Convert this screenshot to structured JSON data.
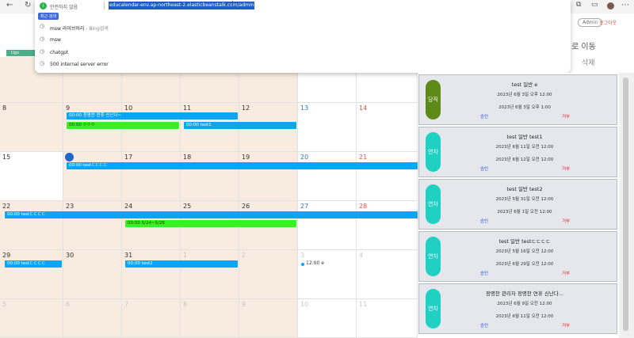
{
  "browser": {
    "security_label": "안전하지 않음",
    "url": "educalendar-env.ap-northeast-2.elasticbeanstalk.com/admin",
    "admin_label": "Admin",
    "logout_label": "로그아웃"
  },
  "omnibox": {
    "section_label": "최근 검색",
    "suggestions": [
      {
        "text": "msw 라이브러리",
        "sub": "- Bing검색"
      },
      {
        "text": "msw",
        "sub": ""
      },
      {
        "text": "chatgpt",
        "sub": ""
      },
      {
        "text": "500 internal server error",
        "sub": ""
      }
    ]
  },
  "header": {
    "move_label": "로 이동",
    "delete_label": "삭제"
  },
  "calendar": {
    "top_labels": [
      "1",
      "Ugo"
    ],
    "weeks": [
      {
        "days": [
          "8",
          "9",
          "10",
          "11",
          "12",
          "13",
          "14"
        ]
      },
      {
        "days": [
          "15",
          "16",
          "17",
          "18",
          "19",
          "20",
          "21"
        ]
      },
      {
        "days": [
          "22",
          "23",
          "24",
          "25",
          "26",
          "27",
          "28"
        ]
      },
      {
        "days": [
          "29",
          "30",
          "31",
          "1",
          "2",
          "3",
          "4"
        ]
      },
      {
        "days": [
          "5",
          "6",
          "7",
          "8",
          "9",
          "10",
          "11"
        ]
      }
    ],
    "events": {
      "e1": "00:00 정명찬 연휴 신난다~",
      "e2": "00:00 ㅇㅇㅇ",
      "e3": "00:00 test1",
      "e4": "00:00 testㄷㄷㄷㄷ",
      "e5": "00:00 testㄷㄷㄷㄷ",
      "e6": "00:00 5/24~5/26",
      "e7": "00:00 testㄷㄷㄷㄷ",
      "e8": "00:00 test2",
      "e9": "12:00 e"
    }
  },
  "cards": [
    {
      "badge": "당직",
      "color": "#5e8a17",
      "title": "test 일반 e",
      "start": "2023년 6월 3일 오후 12:00",
      "end": "2023년 6월 3일 오후 1:00",
      "approve": "승인",
      "reject": "거부"
    },
    {
      "badge": "연차",
      "color": "#1ed1c2",
      "title": "test 일반 test1",
      "start": "2023년 6월 11일 오전 12:00",
      "end": "2023년 6월 12일 오전 12:00",
      "approve": "승인",
      "reject": "거부"
    },
    {
      "badge": "연차",
      "color": "#1ed1c2",
      "title": "test 일반 test2",
      "start": "2023년 5월 31일 오전 12:00",
      "end": "2023년 6월 1일 오전 12:00",
      "approve": "승인",
      "reject": "거부"
    },
    {
      "badge": "연차",
      "color": "#1ed1c2",
      "title": "test 일반 testㄷㄷㄷㄷ",
      "start": "2023년 5월 16일 오전 12:00",
      "end": "2023년 6월 29일 오전 12:00",
      "approve": "승인",
      "reject": "거부"
    },
    {
      "badge": "연차",
      "color": "#1ed1c2",
      "title": "정명찬 관리자 정명찬 연휴 신난다...",
      "start": "2023년 6월 9일 오전 12:00",
      "end": "2023년 6월 11일 오전 12:00",
      "approve": "승인",
      "reject": "거부"
    }
  ]
}
